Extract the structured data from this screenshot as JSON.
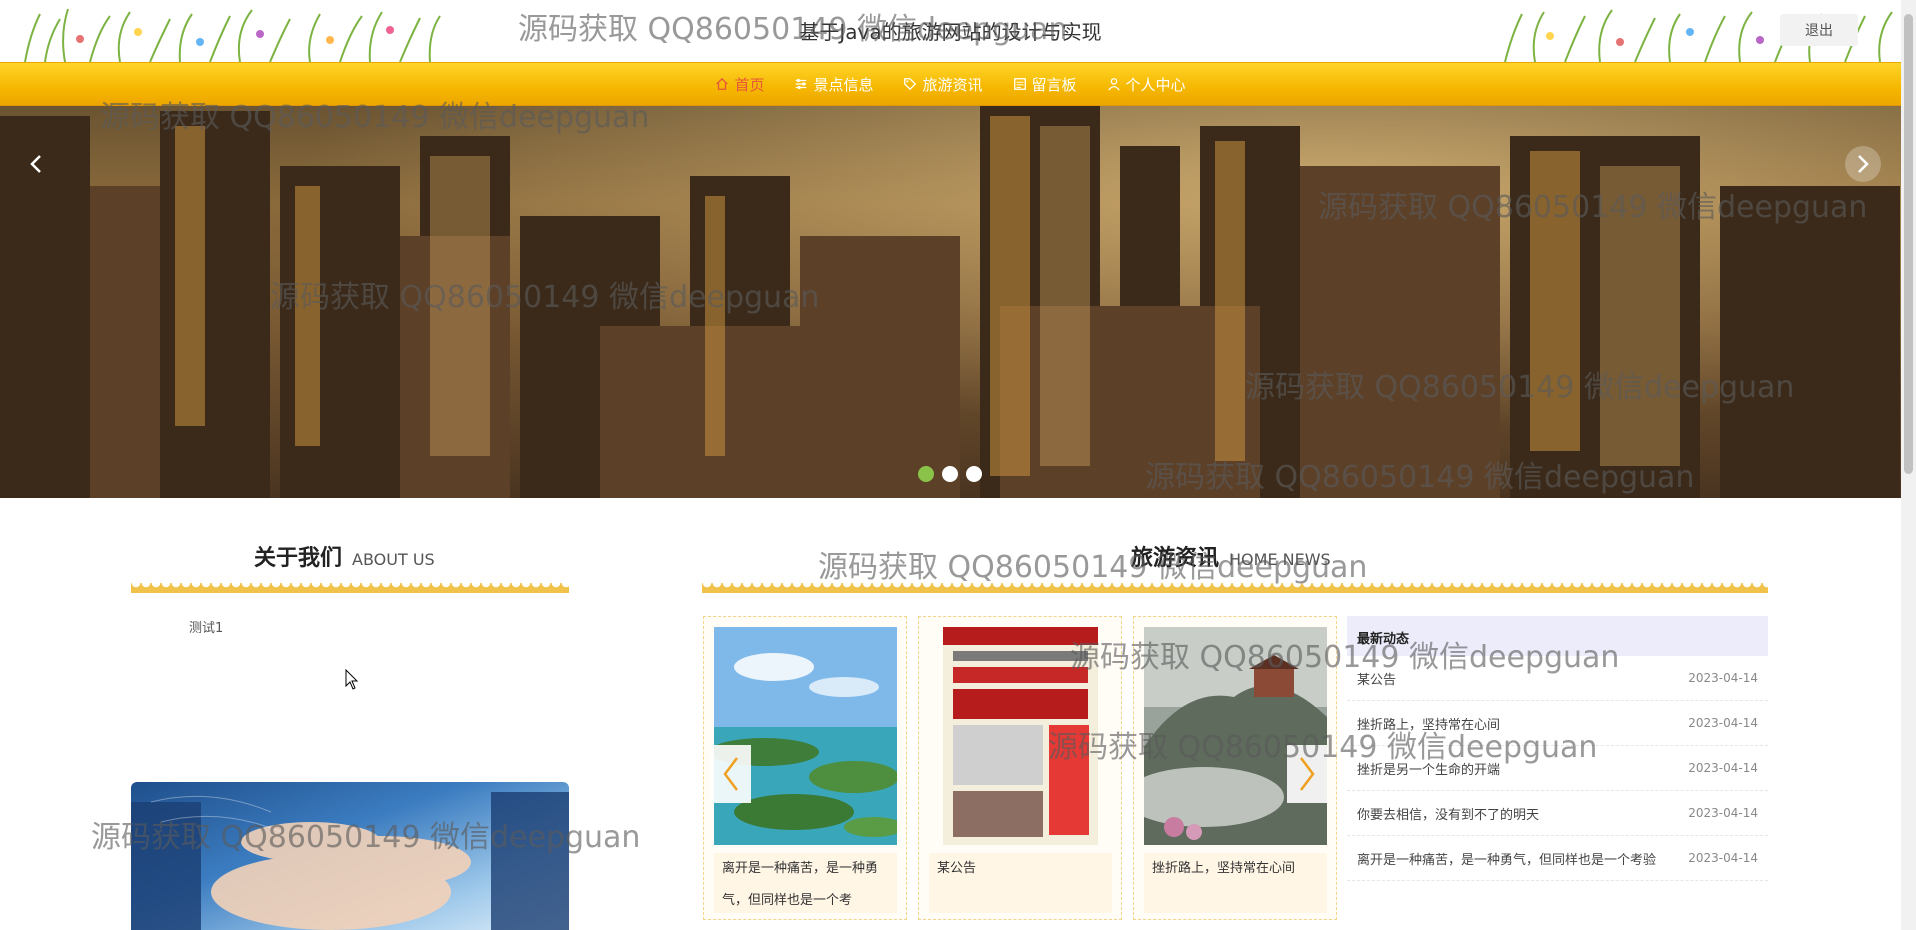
{
  "header": {
    "title": "基于Java的旅游网站的设计与实现",
    "logout_label": "退出"
  },
  "nav": {
    "items": [
      {
        "label": "首页",
        "icon": "home-icon",
        "active": true
      },
      {
        "label": "景点信息",
        "icon": "sliders-icon",
        "active": false
      },
      {
        "label": "旅游资讯",
        "icon": "tag-icon",
        "active": false
      },
      {
        "label": "留言板",
        "icon": "board-icon",
        "active": false
      },
      {
        "label": "个人中心",
        "icon": "user-icon",
        "active": false
      }
    ]
  },
  "banner": {
    "slide_count": 3,
    "active_slide": 1
  },
  "about": {
    "title_cn": "关于我们",
    "title_en": "ABOUT US",
    "text": "测试1"
  },
  "news": {
    "title_cn": "旅游资讯",
    "title_en": "HOME NEWS",
    "cards": [
      {
        "caption": "离开是一种痛苦，是一种勇气，但同样也是一个考"
      },
      {
        "caption": "某公告"
      },
      {
        "caption": "挫折路上，坚持常在心间"
      }
    ],
    "latest_title": "最新动态",
    "latest": [
      {
        "title": "某公告",
        "date": "2023-04-14"
      },
      {
        "title": "挫折路上，坚持常在心间",
        "date": "2023-04-14"
      },
      {
        "title": "挫折是另一个生命的开端",
        "date": "2023-04-14"
      },
      {
        "title": "你要去相信，没有到不了的明天",
        "date": "2023-04-14"
      },
      {
        "title": "离开是一种痛苦，是一种勇气，但同样也是一个考验",
        "date": "2023-04-14"
      }
    ]
  },
  "watermark": "源码获取 QQ86050149 微信deepguan",
  "colors": {
    "nav_bg": "#f5b700",
    "nav_active": "#e8563a",
    "dot_active": "#8bc34a",
    "latest_header": "#ececfb"
  }
}
